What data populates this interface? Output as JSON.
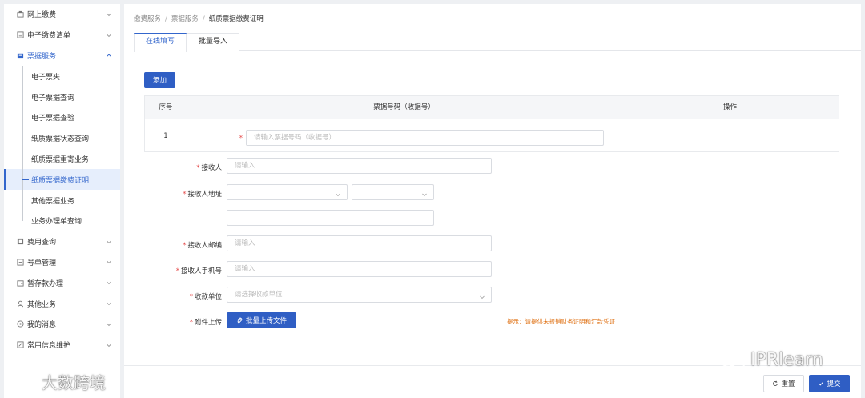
{
  "sidebar": {
    "items": [
      {
        "label": "网上缴费",
        "icon": "online-pay-icon"
      },
      {
        "label": "电子缴费清单",
        "icon": "list-icon"
      },
      {
        "label": "票据服务",
        "icon": "ticket-icon"
      },
      {
        "label": "费用查询",
        "icon": "fee-query-icon"
      },
      {
        "label": "号单管理",
        "icon": "number-manage-icon"
      },
      {
        "label": "暂存款办理",
        "icon": "deposit-icon"
      },
      {
        "label": "其他业务",
        "icon": "other-business-icon"
      },
      {
        "label": "我的消息",
        "icon": "message-icon"
      },
      {
        "label": "常用信息维护",
        "icon": "info-maintain-icon"
      }
    ],
    "sub_items": [
      {
        "label": "电子票夹"
      },
      {
        "label": "电子票据查询"
      },
      {
        "label": "电子票据查验"
      },
      {
        "label": "纸质票据状态查询"
      },
      {
        "label": "纸质票据重寄业务"
      },
      {
        "label": "纸质票据缴费证明"
      },
      {
        "label": "其他票据业务"
      },
      {
        "label": "业务办理单查询"
      }
    ]
  },
  "breadcrumb": {
    "level1": "缴费服务",
    "sep": "/",
    "level2": "票据服务",
    "current": "纸质票据缴费证明"
  },
  "tabs": {
    "online": "在线填写",
    "batch": "批量导入"
  },
  "add_button": "添加",
  "table": {
    "headers": {
      "index": "序号",
      "ticket_no": "票据号码（收据号）",
      "action": "操作"
    },
    "rows": [
      {
        "index": "1",
        "placeholder": "请输入票据号码（收据号）"
      }
    ]
  },
  "form": {
    "required_mark": "*",
    "recipient": {
      "label": "接收人",
      "placeholder": "请输入"
    },
    "address": {
      "label": "接收人地址"
    },
    "postcode": {
      "label": "接收人邮编",
      "placeholder": "请输入"
    },
    "phone": {
      "label": "接收人手机号",
      "placeholder": "请输入"
    },
    "payee": {
      "label": "收款单位",
      "placeholder": "请选择收款单位"
    },
    "attachment": {
      "label": "附件上传",
      "button": "批量上传文件"
    },
    "hint": "提示：请提供未报销财务证明和汇款凭证"
  },
  "footer": {
    "reset": "重置",
    "submit": "提交"
  },
  "watermarks": {
    "left": "大数跨境",
    "right": "IPRlearn"
  },
  "colors": {
    "primary": "#2f5ec4",
    "active_text": "#3366cc",
    "required": "#e54b4b",
    "hint": "#e0761c"
  }
}
